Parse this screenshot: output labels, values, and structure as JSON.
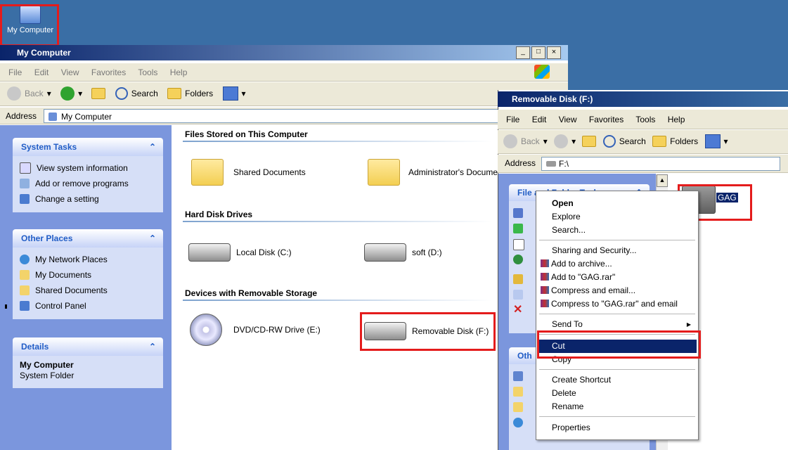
{
  "desktop": {
    "my_computer_label": "My Computer"
  },
  "window_main": {
    "title": "My Computer",
    "title_buttons": [
      "_",
      "□",
      "×"
    ],
    "menu": [
      "File",
      "Edit",
      "View",
      "Favorites",
      "Tools",
      "Help"
    ],
    "toolbar": {
      "back": "Back",
      "search": "Search",
      "folders": "Folders"
    },
    "address_label": "Address",
    "address_value": "My Computer",
    "system_tasks": {
      "title": "System Tasks",
      "items": [
        "View system information",
        "Add or remove programs",
        "Change a setting"
      ]
    },
    "other_places": {
      "title": "Other Places",
      "items": [
        "My Network Places",
        "My Documents",
        "Shared Documents",
        "Control Panel"
      ]
    },
    "details": {
      "title": "Details",
      "name": "My Computer",
      "type": "System Folder"
    },
    "sections": {
      "files": "Files Stored on This Computer",
      "hard": "Hard Disk Drives",
      "removable": "Devices with Removable Storage"
    },
    "items": {
      "shared_docs": "Shared Documents",
      "admin_docs": "Administrator's Docume",
      "local_c": "Local Disk (C:)",
      "soft_d": "soft (D:)",
      "dvd_e": "DVD/CD-RW Drive (E:)",
      "removable_f": "Removable Disk (F:)"
    }
  },
  "window_removable": {
    "title": "Removable Disk (F:)",
    "menu": [
      "File",
      "Edit",
      "View",
      "Favorites",
      "Tools",
      "Help"
    ],
    "toolbar": {
      "back": "Back",
      "search": "Search",
      "folders": "Folders"
    },
    "address_label": "Address",
    "address_value": "F:\\",
    "tasks_title": "File and Folder Tasks",
    "other_title": "Oth",
    "folder_name": "GAG"
  },
  "context_menu": {
    "open": "Open",
    "explore": "Explore",
    "search": "Search...",
    "sharing": "Sharing and Security...",
    "add_archive": "Add to archive...",
    "add_gag": "Add to \"GAG.rar\"",
    "compress_email": "Compress and email...",
    "compress_gag_email": "Compress to \"GAG.rar\" and email",
    "send_to": "Send To",
    "cut": "Cut",
    "copy": "Copy",
    "create_shortcut": "Create Shortcut",
    "delete": "Delete",
    "rename": "Rename",
    "properties": "Properties"
  },
  "colors": {
    "titlebar": "#0a246a",
    "highlight": "#0a246a",
    "annotation": "#e41c1c",
    "desktop": "#3a6ea5"
  }
}
